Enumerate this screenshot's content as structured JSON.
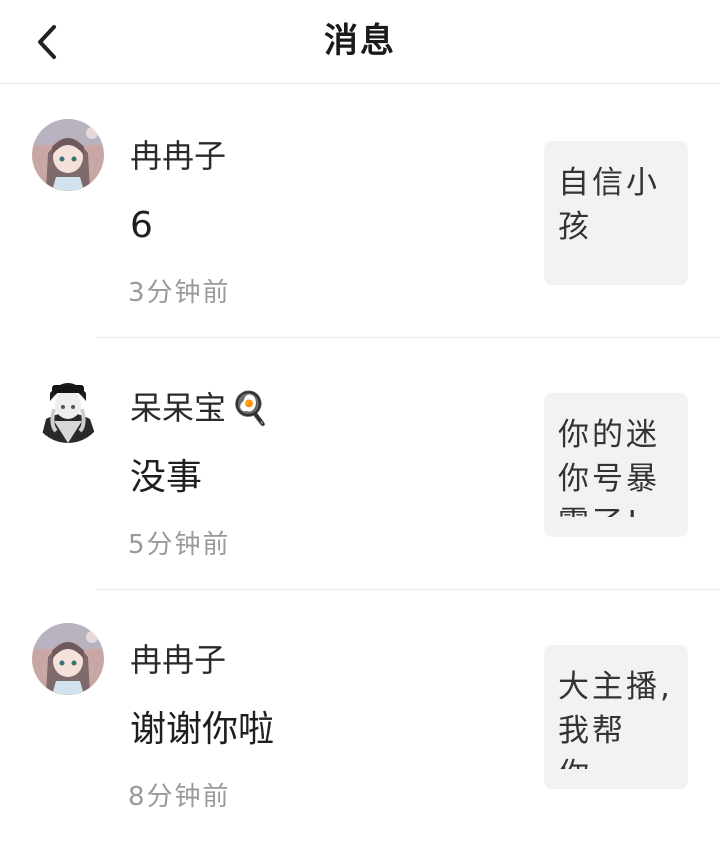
{
  "header": {
    "title": "消息",
    "back_icon": "chevron-left-icon"
  },
  "messages": [
    {
      "name": "冉冉子",
      "emoji": "",
      "content": "6",
      "time": "3分钟前",
      "thumb_text": "自信小孩",
      "avatar": "anime-girl-avatar"
    },
    {
      "name": "呆呆宝",
      "emoji": "🍳",
      "content": "没事",
      "time": "5分钟前",
      "thumb_text": "你的迷你号暴露了!",
      "avatar": "dark-character-avatar"
    },
    {
      "name": "冉冉子",
      "emoji": "",
      "content": "谢谢你啦",
      "time": "8分钟前",
      "thumb_text": "大主播,我帮你...",
      "avatar": "anime-girl-avatar"
    }
  ]
}
